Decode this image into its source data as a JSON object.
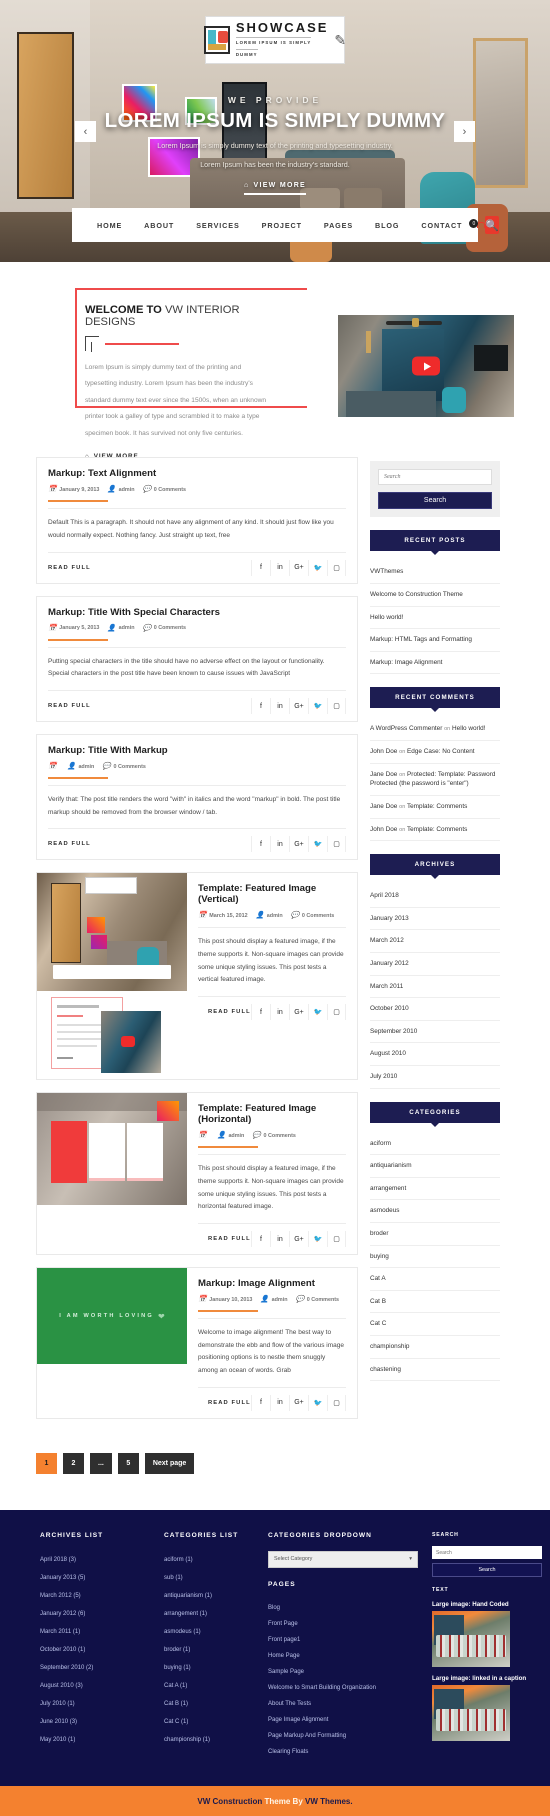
{
  "header": {
    "logo": {
      "title": "SHOWCASE",
      "tagline": "LOREM IPSUM IS SIMPLY DUMMY"
    },
    "nav": [
      {
        "label": "HOME"
      },
      {
        "label": "ABOUT"
      },
      {
        "label": "SERVICES"
      },
      {
        "label": "PROJECT"
      },
      {
        "label": "PAGES"
      },
      {
        "label": "BLOG"
      },
      {
        "label": "CONTACT"
      }
    ],
    "cart_count": "0"
  },
  "hero": {
    "kicker": "WE PROVIDE",
    "title": "LOREM IPSUM IS SIMPLY DUMMY",
    "desc_line1": "Lorem Ipsum is simply dummy text of the printing and typesetting industry.",
    "desc_line2": "Lorem Ipsum has been the industry's standard.",
    "button": "VIEW MORE",
    "prev": "‹",
    "next": "›"
  },
  "welcome": {
    "heading_strong": "WELCOME TO",
    "heading_light": "VW INTERIOR DESIGNS",
    "paragraph": "Lorem Ipsum is simply dummy text of the printing and typesetting industry. Lorem Ipsum has been the industry's standard dummy text ever since the 1500s, when an unknown printer took a galley of type and scrambled it to make a type specimen book. It has survived not only five centuries.",
    "button": "VIEW MORE"
  },
  "posts": [
    {
      "title": "Markup: Text Alignment",
      "date": "January 9, 2013",
      "author": "admin",
      "comments": "0 Comments",
      "excerpt": "Default This is a paragraph. It should not have any alignment of any kind. It should just flow like you would normally expect. Nothing fancy. Just straight up text, free",
      "read_more": "READ FULL",
      "has_media": false
    },
    {
      "title": "Markup: Title With Special Characters",
      "date": "January 5, 2013",
      "author": "admin",
      "comments": "0 Comments",
      "excerpt": "Putting special characters in the title should have no adverse effect on the layout or functionality. Special characters in the post title have been known to cause issues with JavaScript",
      "read_more": "READ FULL",
      "has_media": false
    },
    {
      "title": "Markup: Title With Markup",
      "date": "",
      "author": "admin",
      "comments": "0 Comments",
      "excerpt": "Verify that: The post title renders the word \"with\" in italics and the word \"markup\" in bold. The post title markup should be removed from the browser window / tab.",
      "read_more": "READ FULL",
      "has_media": false
    },
    {
      "title": "Template: Featured Image (Vertical)",
      "date": "March 15, 2012",
      "author": "admin",
      "comments": "0 Comments",
      "excerpt": "This post should display a featured image, if the theme supports it. Non-square images can provide some unique styling issues. This post tests a vertical featured image.",
      "read_more": "READ FULL",
      "has_media": true
    },
    {
      "title": "Template: Featured Image (Horizontal)",
      "date": "",
      "author": "admin",
      "comments": "0 Comments",
      "excerpt": "This post should display a featured image, if the theme supports it. Non-square images can provide some unique styling issues. This post tests a horizontal featured image.",
      "read_more": "READ FULL",
      "has_media": true
    },
    {
      "title": "Markup: Image Alignment",
      "date": "January 10, 2013",
      "author": "admin",
      "comments": "0 Comments",
      "excerpt": "Welcome to image alignment! The best way to demonstrate the ebb and flow of the various image positioning options is to nestle them snuggly among an ocean of words. Grab",
      "read_more": "READ FULL",
      "has_media": true,
      "image_caption": "I AM WORTH LOVING"
    }
  ],
  "social_icons": [
    "facebook-icon",
    "linkedin-icon",
    "google-plus-icon",
    "twitter-icon",
    "instagram-icon"
  ],
  "social_glyphs": [
    "f",
    "in",
    "G+",
    "✈",
    "▣"
  ],
  "sidebar": {
    "search": {
      "placeholder": "Search",
      "button": "Search"
    },
    "recent_posts": {
      "title": "RECENT POSTS",
      "items": [
        "VWThemes",
        "Welcome to Construction Theme",
        "Hello world!",
        "Markup: HTML Tags and Formatting",
        "Markup: Image Alignment"
      ]
    },
    "recent_comments": {
      "title": "RECENT COMMENTS",
      "items": [
        {
          "author": "A WordPress Commenter",
          "on": "on",
          "post": "Hello world!"
        },
        {
          "author": "John Doe",
          "on": "on",
          "post": "Edge Case: No Content"
        },
        {
          "author": "Jane Doe",
          "on": "on",
          "post": "Protected: Template: Password Protected (the password is \"enter\")"
        },
        {
          "author": "Jane Doe",
          "on": "on",
          "post": "Template: Comments"
        },
        {
          "author": "John Doe",
          "on": "on",
          "post": "Template: Comments"
        }
      ]
    },
    "archives": {
      "title": "ARCHIVES",
      "items": [
        "April 2018",
        "January 2013",
        "March 2012",
        "January 2012",
        "March 2011",
        "October 2010",
        "September 2010",
        "August 2010",
        "July 2010"
      ]
    },
    "categories": {
      "title": "CATEGORIES",
      "items": [
        "aciform",
        "antiquarianism",
        "arrangement",
        "asmodeus",
        "broder",
        "buying",
        "Cat A",
        "Cat B",
        "Cat C",
        "championship",
        "chastening"
      ]
    }
  },
  "pagination": [
    {
      "label": "1",
      "active": true
    },
    {
      "label": "2",
      "active": false
    },
    {
      "label": "...",
      "active": false
    },
    {
      "label": "5",
      "active": false
    },
    {
      "label": "Next page",
      "active": false
    }
  ],
  "footer": {
    "archives_list": {
      "title": "ARCHIVES LIST",
      "items": [
        "April 2018 (3)",
        "January 2013 (5)",
        "March 2012 (5)",
        "January 2012 (6)",
        "March 2011 (1)",
        "October 2010 (1)",
        "September 2010 (2)",
        "August 2010 (3)",
        "July 2010 (1)",
        "June 2010 (3)",
        "May 2010 (1)"
      ]
    },
    "categories_list": {
      "title": "CATEGORIES LIST",
      "items": [
        "aciform (1)",
        "sub (1)",
        "antiquarianism (1)",
        "arrangement (1)",
        "asmodeus (1)",
        "broder (1)",
        "buying (1)",
        "Cat A (1)",
        "Cat B (1)",
        "Cat C (1)",
        "championship (1)"
      ]
    },
    "categories_dropdown": {
      "title": "CATEGORIES DROPDOWN",
      "selected": "Select Category"
    },
    "pages": {
      "title": "PAGES",
      "items": [
        "Blog",
        "Front Page",
        "Front page1",
        "Home Page",
        "Sample Page",
        "Welcome to Smart Building Organization",
        "About The Tests",
        "Page Image Alignment",
        "Page Markup And Formatting",
        "Clearing Floats"
      ]
    },
    "search": {
      "title": "SEARCH",
      "placeholder": "Search",
      "button": "Search"
    },
    "text_widget": {
      "title": "TEXT",
      "caption1": "Large image: Hand Coded",
      "caption2": "Large image: linked in a caption"
    },
    "bottom": {
      "text": "VW Construction ",
      "highlight": "Theme By ",
      "text2": "VW Themes."
    }
  },
  "colors": {
    "navy": "#1d1d52",
    "footer_navy": "#101047",
    "orange": "#f4812f",
    "accent_orange": "#f08a3c",
    "red": "#e8392c",
    "green": "#2a9244"
  }
}
